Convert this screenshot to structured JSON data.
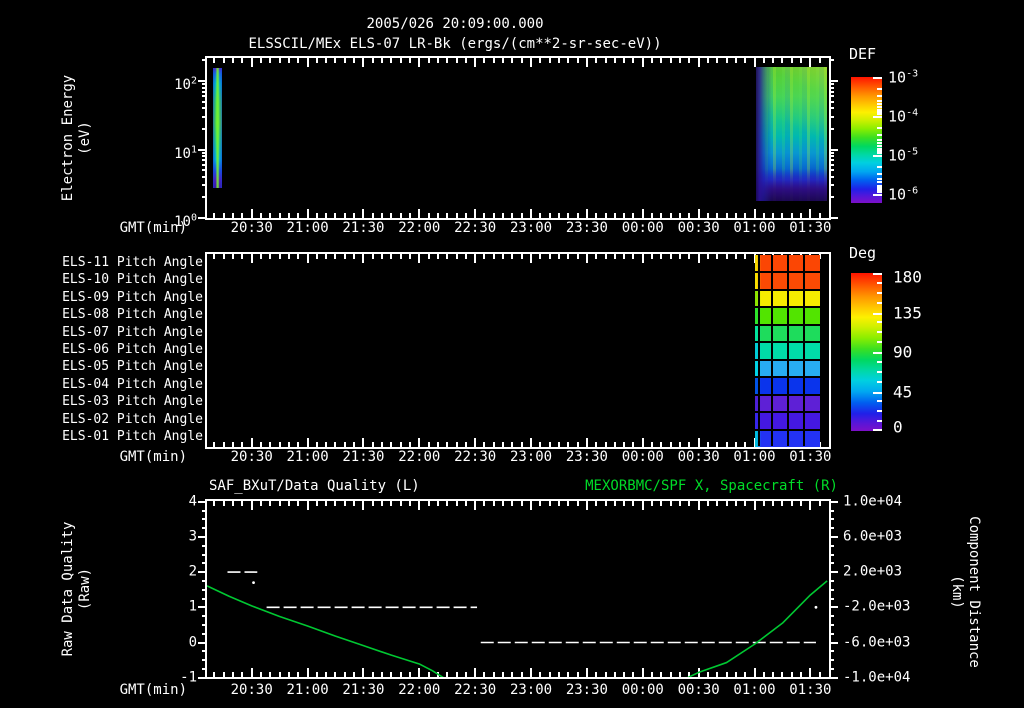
{
  "header": {
    "timestamp": "2005/026 20:09:00.000",
    "instrument_line": "ELSSCIL/MEx ELS-07 LR-Bk  (ergs/(cm**2-sr-sec-eV))"
  },
  "time_axis": {
    "axis_label": "GMT(min)",
    "start": "20:06",
    "end": "01:40",
    "major_tick_labels": [
      "20:30",
      "21:00",
      "21:30",
      "22:00",
      "22:30",
      "23:00",
      "23:30",
      "00:00",
      "00:30",
      "01:00",
      "01:30"
    ],
    "minor_tick_minutes": 5
  },
  "panel_energy": {
    "ylabel": [
      "Electron Energy",
      "(eV)"
    ],
    "ytick_exponents": [
      2,
      1,
      0
    ],
    "colorbar": {
      "title": "DEF",
      "tick_exponents": [
        -3,
        -4,
        -5,
        -6
      ]
    }
  },
  "panel_pitch": {
    "row_labels": [
      "ELS-11 Pitch Angle",
      "ELS-10 Pitch Angle",
      "ELS-09 Pitch Angle",
      "ELS-08 Pitch Angle",
      "ELS-07 Pitch Angle",
      "ELS-06 Pitch Angle",
      "ELS-05 Pitch Angle",
      "ELS-04 Pitch Angle",
      "ELS-03 Pitch Angle",
      "ELS-02 Pitch Angle",
      "ELS-01 Pitch Angle"
    ],
    "colorbar": {
      "title": "Deg",
      "tick_labels": [
        "180",
        "135",
        "90",
        "45",
        "0"
      ]
    },
    "block": {
      "t0": "01:00",
      "t1": "01:35",
      "rows": [
        {
          "deg": 168,
          "base": "#fb4604",
          "edge": "#f4d800"
        },
        {
          "deg": 165,
          "base": "#fb4a04",
          "edge": "#f8e000"
        },
        {
          "deg": 135,
          "base": "#f6ec00",
          "edge": "#8ce400"
        },
        {
          "deg": 112,
          "base": "#52e400",
          "edge": "#2ce42c"
        },
        {
          "deg": 98,
          "base": "#1edc5c",
          "edge": "#00e4a0"
        },
        {
          "deg": 84,
          "base": "#00dca8",
          "edge": "#00ccd8"
        },
        {
          "deg": 62,
          "base": "#28acf2",
          "edge": "#00d4e4"
        },
        {
          "deg": 36,
          "base": "#0a34ec",
          "edge": "#0054e6"
        },
        {
          "deg": 10,
          "base": "#5e20d6",
          "edge": "#4c20d6"
        },
        {
          "deg": 18,
          "base": "#4418e2",
          "edge": "#3626ea"
        },
        {
          "deg": 30,
          "base": "#2332f4",
          "edge": "#00bede"
        }
      ]
    }
  },
  "panel_quality": {
    "title_left": "SAF_BXuT/Data Quality (L)",
    "title_right": "MEXORBMC/SPF X, Spacecraft (R)",
    "ylabel_left": [
      "Raw Data Quality",
      "(Raw)"
    ],
    "ylabel_right": [
      "Component Distance",
      "(km)"
    ],
    "yticks_left": [
      "4",
      "3",
      "2",
      "1",
      "0",
      "-1"
    ],
    "yticks_right": [
      "1.0e+04",
      "6.0e+03",
      "2.0e+03",
      "-2.0e+03",
      "-6.0e+03",
      "-1.0e+04"
    ]
  },
  "colors": {
    "background": "#000000",
    "frame_white": "#ffffff",
    "title_green": "#00dc28",
    "curve_green": "#00c832",
    "quality_line_white": "#ffffff"
  },
  "chart_data": [
    {
      "type": "heatmap",
      "panel": "electron-energy-spectrogram",
      "title": "ELSSCIL/MEx ELS-07 LR-Bk (ergs/(cm**2-sr-sec-eV))",
      "subtitle": "2005/026 20:09:00.000",
      "xlabel": "GMT(min)",
      "ylabel": "Electron Energy (eV)",
      "y_scale": "log",
      "ylim": [
        1,
        215
      ],
      "x_range": [
        "20:06",
        "01:40"
      ],
      "colorbar": {
        "title": "DEF",
        "scale": "log",
        "tick_values": [
          "1e-3",
          "1e-4",
          "1e-5",
          "1e-6"
        ],
        "palette": "rainbow red(top) to violet(bottom)"
      },
      "features": [
        {
          "name": "startup-burst",
          "t0": "20:09",
          "t1": "20:14",
          "e_hi": 155,
          "e_lo": 2.7,
          "desc": "narrow cyan/green column with purple top and bottom edges, flux ~1e-5..1e-4"
        },
        {
          "name": "main-blob",
          "t0": "01:01",
          "t1": "01:39",
          "e_hi": 160,
          "e_lo": 1.8,
          "desc": "green-cyan body, yellow-green streaks at high energy upper right, blue-purple speckled left edge and low-energy band"
        }
      ]
    },
    {
      "type": "heatmap",
      "panel": "pitch-angles",
      "categories": [
        "ELS-11",
        "ELS-10",
        "ELS-09",
        "ELS-08",
        "ELS-07",
        "ELS-06",
        "ELS-05",
        "ELS-04",
        "ELS-03",
        "ELS-02",
        "ELS-01"
      ],
      "t0": "01:00",
      "t1": "01:35",
      "values_deg": [
        168,
        165,
        135,
        112,
        98,
        84,
        62,
        36,
        10,
        18,
        30
      ],
      "colorbar": {
        "title": "Deg",
        "ticks": [
          180,
          135,
          90,
          45,
          0
        ]
      }
    },
    {
      "type": "line",
      "panel": "data-quality-and-distance",
      "title_left": "SAF_BXuT/Data Quality (L)",
      "title_right": "MEXORBMC/SPF X, Spacecraft (R)",
      "xlabel": "GMT(min)",
      "x_range": [
        "20:06",
        "01:40"
      ],
      "left_axis": {
        "label": "Raw Data Quality (Raw)",
        "range": [
          -1,
          4
        ]
      },
      "right_axis": {
        "label": "Component Distance (km)",
        "range": [
          -10000,
          10000
        ]
      },
      "quality_segments": [
        {
          "from": "20:17",
          "to": "20:33",
          "value": 2
        },
        {
          "from": "20:38",
          "to": "22:31",
          "value": 1
        },
        {
          "from": "22:33",
          "to": "01:33",
          "value": 0
        }
      ],
      "quality_stray_points": [
        {
          "t": "20:31",
          "value": 1.7
        },
        {
          "t": "01:33",
          "value": 1.0
        }
      ],
      "distance_km_series": {
        "segment1": [
          [
            "20:06",
            440
          ],
          [
            "20:18",
            -760
          ],
          [
            "20:30",
            -1840
          ],
          [
            "20:45",
            -3040
          ],
          [
            "21:00",
            -4120
          ],
          [
            "21:15",
            -5280
          ],
          [
            "21:30",
            -6360
          ],
          [
            "21:45",
            -7440
          ],
          [
            "22:00",
            -8440
          ],
          [
            "22:07",
            -9200
          ],
          [
            "22:13",
            -10000
          ]
        ],
        "segment2": [
          [
            "00:24",
            -10000
          ],
          [
            "00:30",
            -9400
          ],
          [
            "00:45",
            -8280
          ],
          [
            "01:00",
            -6200
          ],
          [
            "01:15",
            -3800
          ],
          [
            "01:30",
            -600
          ],
          [
            "01:39",
            1000
          ]
        ],
        "note": "green curve clipped below -1.0e+04 km between 22:13 and 00:24"
      }
    }
  ]
}
